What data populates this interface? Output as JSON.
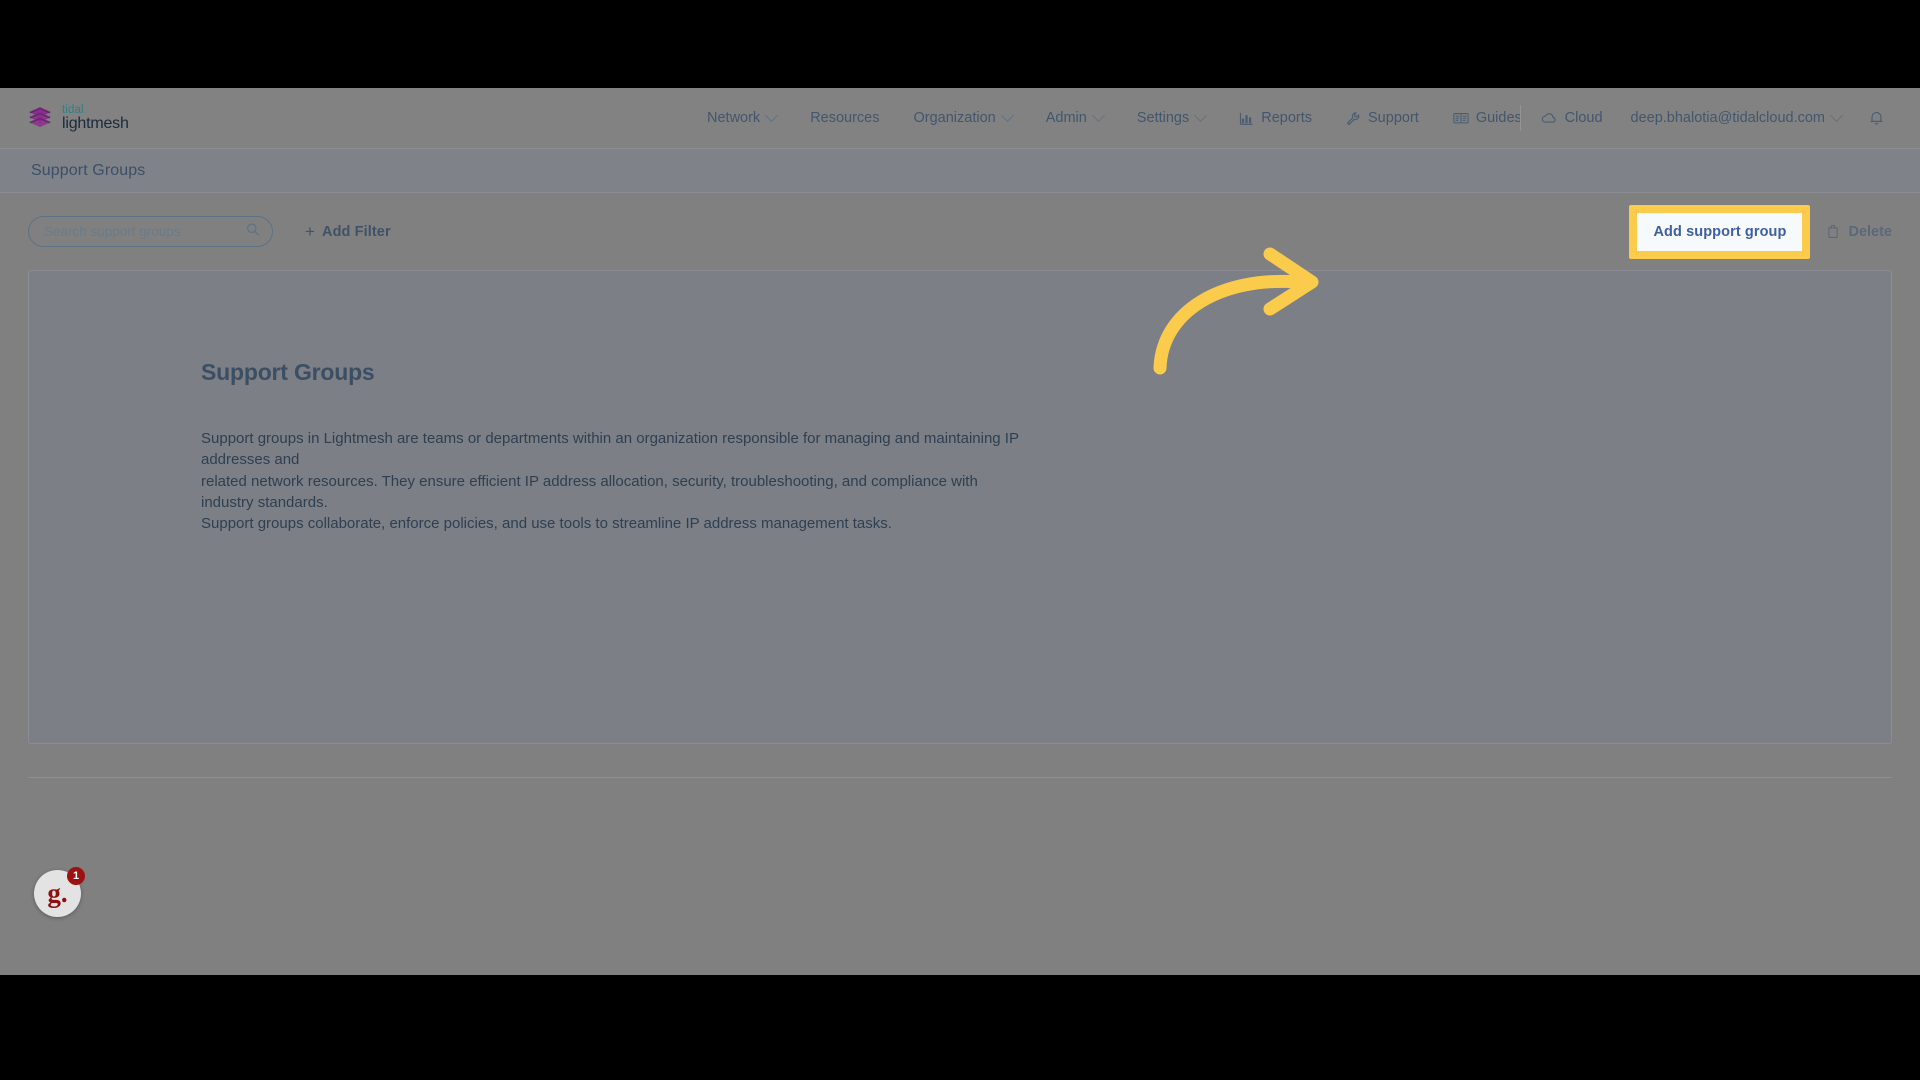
{
  "brand": {
    "top": "tidal",
    "bottom": "lightmesh",
    "logo_icon": "stacked-layers-icon",
    "accent_teal": "#2f7f87",
    "accent_purple": "#8e2c8e"
  },
  "nav": {
    "items": [
      {
        "label": "Network",
        "has_caret": true
      },
      {
        "label": "Resources",
        "has_caret": false
      },
      {
        "label": "Organization",
        "has_caret": true
      },
      {
        "label": "Admin",
        "has_caret": true
      },
      {
        "label": "Settings",
        "has_caret": true
      },
      {
        "label": "Reports",
        "has_caret": false,
        "icon": "bar-chart-icon"
      },
      {
        "label": "Support",
        "has_caret": false,
        "icon": "wrench-icon"
      },
      {
        "label": "Guides",
        "has_caret": false,
        "icon": "book-icon"
      }
    ],
    "right": {
      "cloud_label": "Cloud",
      "cloud_icon": "cloud-icon",
      "account_email": "deep.bhalotia@tidalcloud.com",
      "account_caret": true,
      "notifications_icon": "bell-icon"
    }
  },
  "titlebar": {
    "title": "Support Groups"
  },
  "toolbar": {
    "search_placeholder": "Search support groups",
    "search_value": "",
    "search_icon": "search-icon",
    "add_filter_label": "Add Filter",
    "add_filter_icon": "plus-icon",
    "add_group_label": "Add support group",
    "delete_label": "Delete",
    "delete_icon": "trash-icon",
    "highlight_color": "#FBCB4B"
  },
  "main": {
    "heading": "Support Groups",
    "paragraph_lines": [
      "Support groups in Lightmesh are teams or departments within an organization responsible for managing and maintaining IP addresses and",
      "related network resources. They ensure efficient IP address allocation, security, troubleshooting, and compliance with industry standards.",
      "Support groups collaborate, enforce policies, and use tools to streamline IP address management tasks."
    ]
  },
  "annotation": {
    "arrow_icon": "curved-arrow-icon",
    "arrow_color": "#FBCB4B"
  },
  "widget": {
    "logo_text": "g.",
    "badge_count": "1"
  }
}
